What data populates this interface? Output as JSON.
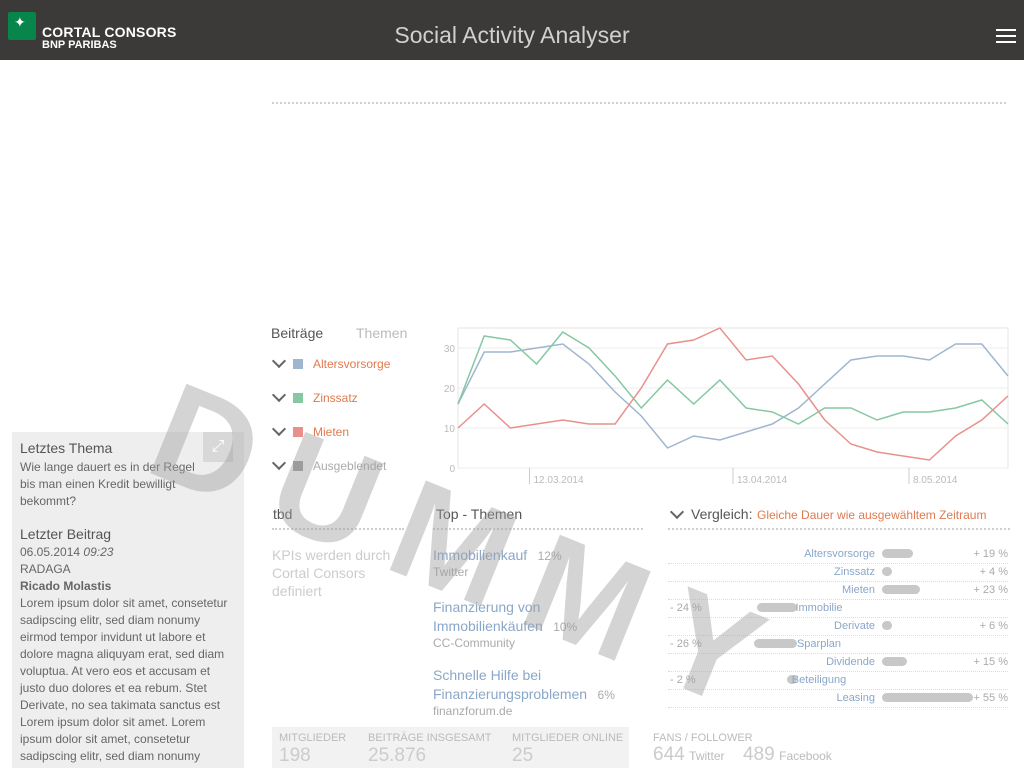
{
  "header": {
    "brand_line1": "CORTAL CONSORS",
    "brand_line2": "BNP PARIBAS",
    "title": "Social Activity Analyser",
    "logo_icon": "bnp-star-icon",
    "menu_icon": "hamburger-icon"
  },
  "left_panel": {
    "last_topic_heading": "Letztes Thema",
    "last_topic_text": "Wie lange dauert es in der Regel bis man einen Kredit bewilligt bekommt?",
    "last_post_heading": "Letzter Beitrag",
    "post_date": "06.05.2014",
    "post_time": "09:23",
    "post_source": "RADAGA",
    "post_author": "Ricado Molastis",
    "post_body": "Lorem ipsum dolor sit amet, consetetur sadipscing elitr, sed diam nonumy eirmod tempor invidunt ut labore et dolore magna aliquyam erat, sed diam voluptua. At vero eos et accusam et justo duo dolores et ea rebum. Stet Derivate, no sea takimata sanctus est Lorem ipsum dolor sit amet. Lorem ipsum dolor sit amet, consetetur sadipscing elitr, sed diam nonumy",
    "expand_icon": "expand-arrows-icon"
  },
  "tabs": [
    "Beiträge",
    "Themen"
  ],
  "legend": [
    {
      "label": "Altersvorsorge",
      "color": "#9fb6cf"
    },
    {
      "label": "Zinssatz",
      "color": "#86c8a2"
    },
    {
      "label": "Mieten",
      "color": "#e8908c"
    },
    {
      "label": "Ausgeblendet",
      "color": "#999999"
    }
  ],
  "chart_data": {
    "type": "line",
    "x_ticks": [
      "12.03.2014",
      "13.04.2014",
      "8.05.2014"
    ],
    "y_ticks": [
      "0",
      "10",
      "20",
      "30"
    ],
    "ylim": [
      0,
      35
    ],
    "grid": true,
    "series": [
      {
        "name": "Altersvorsorge",
        "color": "#9fb6cf",
        "values": [
          16,
          29,
          29,
          30,
          31,
          26,
          19,
          13,
          5,
          8,
          7,
          9,
          11,
          15,
          21,
          27,
          28,
          28,
          27,
          31,
          31,
          23
        ]
      },
      {
        "name": "Zinssatz",
        "color": "#86c8a2",
        "values": [
          16,
          33,
          32,
          26,
          34,
          30,
          23,
          15,
          22,
          16,
          22,
          15,
          14,
          11,
          15,
          15,
          12,
          14,
          14,
          15,
          17,
          11
        ]
      },
      {
        "name": "Mieten",
        "color": "#e8908c",
        "values": [
          10,
          16,
          10,
          11,
          12,
          11,
          11,
          20,
          31,
          32,
          35,
          27,
          28,
          21,
          12,
          6,
          4,
          3,
          2,
          8,
          12,
          18
        ]
      }
    ]
  },
  "tbd": {
    "title": "tbd",
    "text": "KPIs werden durch Cortal Consors definiert"
  },
  "top_themen": {
    "title": "Top - Themen",
    "items": [
      {
        "name": "Immobilienkauf",
        "pct": "12%",
        "source": "Twitter"
      },
      {
        "name": "Finanzierung von Immobilienkäufen",
        "pct": "10%",
        "source": "CC-Community"
      },
      {
        "name": "Schnelle Hilfe bei Finanzierungsproblemen",
        "pct": "6%",
        "source": "finanzforum.de"
      }
    ]
  },
  "vergleich": {
    "label": "Vergleich:",
    "period": "Gleiche Dauer wie ausgewähltem Zeitraum",
    "rows": [
      {
        "label": "Altersvorsorge",
        "value": 19,
        "text": "+ 19 %"
      },
      {
        "label": "Zinssatz",
        "value": 4,
        "text": "+ 4 %"
      },
      {
        "label": "Mieten",
        "value": 23,
        "text": "+ 23 %"
      },
      {
        "label": "Immobilie",
        "value": -24,
        "text": "- 24 %"
      },
      {
        "label": "Derivate",
        "value": 6,
        "text": "+ 6 %"
      },
      {
        "label": "Sparplan",
        "value": -26,
        "text": "- 26 %"
      },
      {
        "label": "Dividende",
        "value": 15,
        "text": "+ 15 %"
      },
      {
        "label": "Beteiligung",
        "value": -2,
        "text": "- 2 %"
      },
      {
        "label": "Leasing",
        "value": 55,
        "text": "+ 55 %"
      }
    ]
  },
  "kpis": [
    {
      "label": "MITGLIEDER",
      "value": "198"
    },
    {
      "label": "BEITRÄGE INSGESAMT",
      "value": "25.876"
    },
    {
      "label": "MITGLIEDER ONLINE",
      "value": "25"
    }
  ],
  "fans": {
    "label": "FANS / FOLLOWER",
    "twitter_value": "644",
    "twitter_label": "Twitter",
    "facebook_value": "489",
    "facebook_label": "Facebook"
  },
  "watermark": "DUMMY"
}
